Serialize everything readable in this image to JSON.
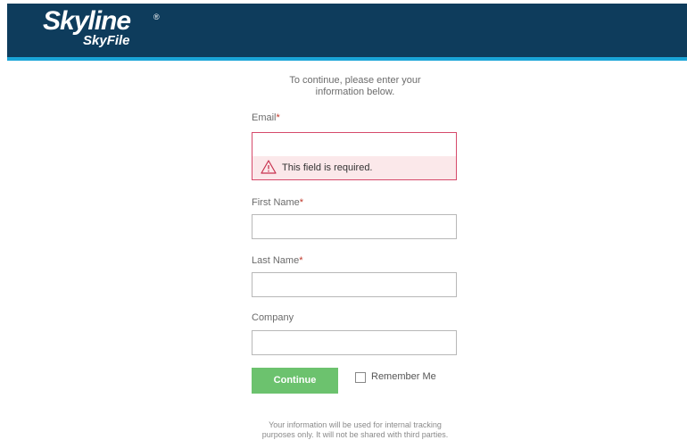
{
  "header": {
    "logo_main": "Skyline",
    "logo_reg": "®",
    "logo_sub": "SkyFile",
    "bg_color": "#0e3c5c",
    "accent_color": "#1aa5d8"
  },
  "intro": {
    "line1": "To continue, please enter your",
    "line2": "information below."
  },
  "form": {
    "required_mark": "*",
    "email": {
      "label": "Email",
      "value": "",
      "error": "This field is required."
    },
    "first_name": {
      "label": "First Name",
      "value": ""
    },
    "last_name": {
      "label": "Last Name",
      "value": ""
    },
    "company": {
      "label": "Company",
      "value": ""
    },
    "continue_label": "Continue",
    "continue_color": "#6cc26e",
    "remember_label": "Remember Me",
    "remember_checked": false,
    "error_color": "#d64a6b"
  },
  "footer": {
    "line1": "Your information will be used for internal tracking",
    "line2": "purposes only. It will not be shared with third parties."
  },
  "icons": [
    "warning-icon",
    "checkbox-icon"
  ]
}
